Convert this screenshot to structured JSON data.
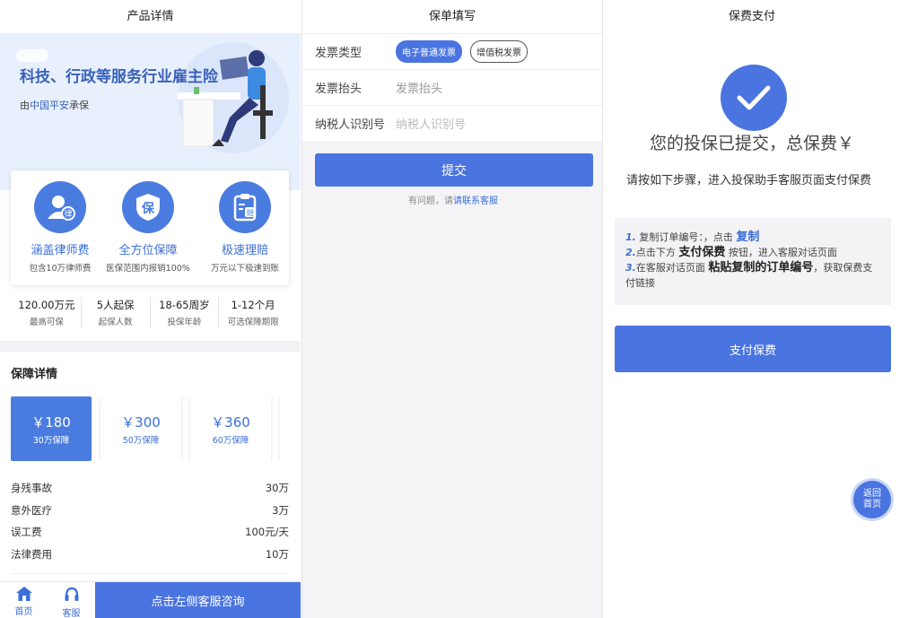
{
  "product": {
    "header_title": "产品详情",
    "hero_title": "科技、行政等服务行业雇主险",
    "hero_sub_prefix": "由",
    "hero_sub_brand": "中国平安",
    "hero_sub_suffix": "承保",
    "features": [
      {
        "icon": "lawyer-icon",
        "icon_char": "律",
        "title": "涵盖律师费",
        "desc": "包含10万律师费"
      },
      {
        "icon": "shield-icon",
        "icon_char": "保",
        "title": "全方位保障",
        "desc": "医保范围内报销100%"
      },
      {
        "icon": "claim-icon",
        "icon_char": "赔",
        "title": "极速理赔",
        "desc": "万元以下极速到账"
      }
    ],
    "stats": [
      {
        "value": "120.00万元",
        "label": "最高可保"
      },
      {
        "value": "5人起保",
        "label": "起保人数"
      },
      {
        "value": "18-65周岁",
        "label": "投保年龄"
      },
      {
        "value": "1-12个月",
        "label": "可选保障期限"
      }
    ],
    "section_title": "保障详情",
    "plans": [
      {
        "price": "￥180",
        "coverage": "30万保障",
        "active": true
      },
      {
        "price": "￥300",
        "coverage": "50万保障",
        "active": false
      },
      {
        "price": "￥360",
        "coverage": "60万保障",
        "active": false
      },
      {
        "price": "",
        "coverage": "",
        "active": false
      }
    ],
    "coverage_rows": [
      {
        "label": "身残事故",
        "value": "30万"
      },
      {
        "label": "意外医疗",
        "value": "3万"
      },
      {
        "label": "误工费",
        "value": "100元/天"
      },
      {
        "label": "法律费用",
        "value": "10万"
      }
    ],
    "bottom": {
      "home_label": "首页",
      "service_label": "客服",
      "cta_label": "点击左侧客服咨询"
    }
  },
  "form": {
    "header_title": "保单填写",
    "invoice_type_label": "发票类型",
    "invoice_options": [
      {
        "label": "电子普通发票",
        "selected": true
      },
      {
        "label": "增值税发票",
        "selected": false
      }
    ],
    "invoice_title_label": "发票抬头",
    "invoice_title_placeholder": "发票抬头",
    "tax_id_label": "纳税人识别号",
    "tax_id_placeholder": "纳税人识别号",
    "submit_label": "提交",
    "help_prefix": "有问题，请",
    "help_link": "请联系客服"
  },
  "payment": {
    "header_title": "保费支付",
    "done_title": "您的投保已提交，总保费￥",
    "intro": "请按如下步骤，进入投保助手客服页面支付保费",
    "step1_num": "1.",
    "step1_text": "复制订单编号：，点击",
    "step1_hl": "复制",
    "step2_num": "2.",
    "step2_pre": "点击下方",
    "step2_hl": "支付保费",
    "step2_post": "按钮，进入客服对话页面",
    "step3_num": "3.",
    "step3_pre": "在客服对话页面",
    "step3_hl": "粘贴复制的订单编号",
    "step3_post": "，获取保费支付链接",
    "pay_label": "支付保费",
    "home_float_line1": "返回",
    "home_float_line2": "首页"
  },
  "colors": {
    "accent": "#4a74e0",
    "hero_bg": "#e9f0fd"
  }
}
